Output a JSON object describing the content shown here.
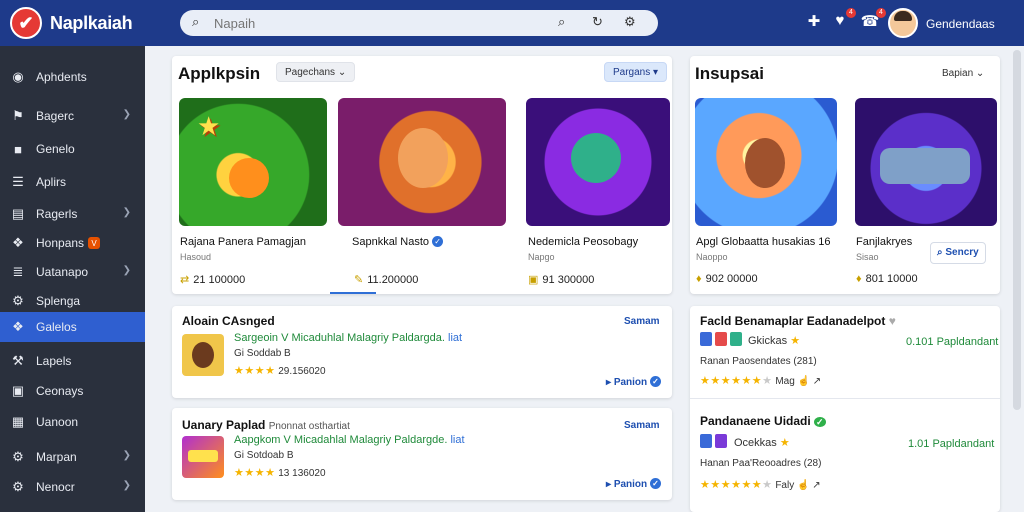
{
  "app": {
    "title": "Naplkaiah",
    "logo_glyph": "✔"
  },
  "search": {
    "placeholder": "Napaih"
  },
  "header": {
    "user_name": "Gendendaas",
    "badges": [
      "4",
      "4"
    ]
  },
  "sidebar": {
    "items": [
      {
        "label": "Aphdents",
        "icon": "home-icon"
      },
      {
        "label": "Bagerc",
        "icon": "flag-icon",
        "chevron": true
      },
      {
        "label": "Genelo",
        "icon": "folder-icon"
      },
      {
        "label": "Aplirs",
        "icon": "apps-icon"
      },
      {
        "label": "Ragerls",
        "icon": "document-icon",
        "chevron": true
      },
      {
        "label": "Honpans",
        "icon": "gamepad-icon",
        "badge": "V"
      },
      {
        "label": "Uatanapo",
        "icon": "list-icon",
        "chevron": true
      },
      {
        "label": "Splenga",
        "icon": "settings-icon"
      },
      {
        "label": "Galelos",
        "icon": "gamepad-icon",
        "active": true
      },
      {
        "label": "Lapels",
        "icon": "tools-icon"
      },
      {
        "label": "Ceonays",
        "icon": "box-icon"
      },
      {
        "label": "Uanoon",
        "icon": "grid-icon"
      },
      {
        "label": "Marpan",
        "icon": "gear-icon",
        "chevron": true
      },
      {
        "label": "Nenocr",
        "icon": "settings-icon",
        "chevron": true
      }
    ]
  },
  "featured": {
    "title": "Applkpsin",
    "filter": "Pagechans",
    "sort": "Pargans",
    "apps": [
      {
        "name": "Rajana Panera Pamagjan",
        "sub": "Hasoud",
        "count": "21 100000",
        "count_icon": "⇄"
      },
      {
        "name": "Sapnkkal Nasto",
        "sub": "",
        "count": "11.200000",
        "count_icon": "✎",
        "verified": true
      },
      {
        "name": "Nedemicla Peosobagy",
        "sub": "Napgo",
        "count": "91 300000",
        "count_icon": "▣"
      }
    ]
  },
  "inspired": {
    "title": "Insupsai",
    "sort": "Bapian",
    "see_more": "Sencry",
    "apps": [
      {
        "name": "Apgl Globaatta husakias 16",
        "sub": "Naoppo",
        "count": "902 00000",
        "count_icon": "♦"
      },
      {
        "name": "Fanjlakryes",
        "sub": "Sisao",
        "count": "801 10000",
        "count_icon": "♦"
      }
    ]
  },
  "list_left": [
    {
      "title": "Aloain CAsnged",
      "link": "Samam",
      "line1": "Sargeoin V Micaduhlal Malagriy Paldargda. ",
      "tag": "liat",
      "line2": "Gi Soddab B",
      "rating": 4,
      "rating_count": "29.156020",
      "footer": "Panion"
    },
    {
      "title": "Uanary Paplad",
      "subtitle": "Pnonnat osthartiat",
      "link": "Samam",
      "line1": "Aapgkom V Micadahlal Malagriy Paldargde. ",
      "tag": "liat",
      "line2": "Gi Sotdoab B",
      "rating": 4,
      "rating_count": "13 136020",
      "footer": "Panion"
    }
  ],
  "list_right": [
    {
      "title": "Facld Benamaplar Eadanadelpot",
      "label": "Gkickas",
      "value": "0.101 Papldandant",
      "line2": "Ranan Paosendates (281)",
      "rating": 6,
      "rating_of": 7,
      "extra": "Mag"
    },
    {
      "title": "Pandanaene Uidadi",
      "label": "Ocekkas",
      "value": "1.01 Papldandant",
      "line2": "Hanan Paa'Reooadres (28)",
      "rating": 6,
      "rating_of": 7,
      "extra": "Faly"
    }
  ],
  "colors": {
    "topbar": "#1e3a8a",
    "sidebar": "#2a303d",
    "active": "#2f5fd0",
    "link": "#1e4fb0",
    "green": "#1f8a3a",
    "star": "#f5b400"
  }
}
